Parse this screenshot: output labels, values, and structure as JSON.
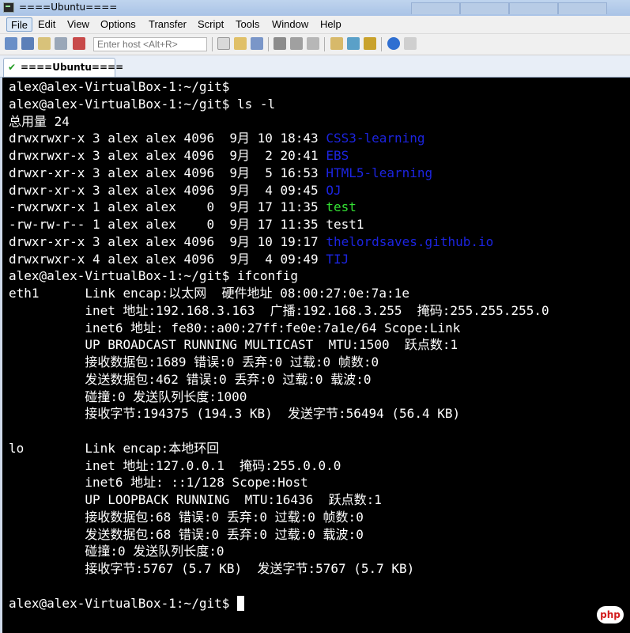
{
  "window": {
    "title": "====Ubuntu===="
  },
  "menu": [
    "File",
    "Edit",
    "View",
    "Options",
    "Transfer",
    "Script",
    "Tools",
    "Window",
    "Help"
  ],
  "toolbar": {
    "quick_connect_placeholder": "Enter host <Alt+R>"
  },
  "tabs": [
    {
      "label": "====Ubuntu===="
    }
  ],
  "terminal": {
    "lines": [
      {
        "segs": [
          {
            "t": "alex@alex-VirtualBox-1:~/git$",
            "c": ""
          }
        ]
      },
      {
        "segs": [
          {
            "t": "alex@alex-VirtualBox-1:~/git$ ls -l",
            "c": ""
          }
        ]
      },
      {
        "segs": [
          {
            "t": "总用量 24",
            "c": ""
          }
        ]
      },
      {
        "segs": [
          {
            "t": "drwxrwxr-x 3 alex alex 4096  9月 10 18:43 ",
            "c": ""
          },
          {
            "t": "CSS3-learning",
            "c": "blue"
          }
        ]
      },
      {
        "segs": [
          {
            "t": "drwxrwxr-x 3 alex alex 4096  9月  2 20:41 ",
            "c": ""
          },
          {
            "t": "EBS",
            "c": "blue"
          }
        ]
      },
      {
        "segs": [
          {
            "t": "drwxr-xr-x 3 alex alex 4096  9月  5 16:53 ",
            "c": ""
          },
          {
            "t": "HTML5-learning",
            "c": "blue"
          }
        ]
      },
      {
        "segs": [
          {
            "t": "drwxr-xr-x 3 alex alex 4096  9月  4 09:45 ",
            "c": ""
          },
          {
            "t": "OJ",
            "c": "blue"
          }
        ]
      },
      {
        "segs": [
          {
            "t": "-rwxrwxr-x 1 alex alex    0  9月 17 11:35 ",
            "c": ""
          },
          {
            "t": "test",
            "c": "green"
          }
        ]
      },
      {
        "segs": [
          {
            "t": "-rw-rw-r-- 1 alex alex    0  9月 17 11:35 test1",
            "c": ""
          }
        ]
      },
      {
        "segs": [
          {
            "t": "drwxr-xr-x 3 alex alex 4096  9月 10 19:17 ",
            "c": ""
          },
          {
            "t": "thelordsaves.github.io",
            "c": "blue"
          }
        ]
      },
      {
        "segs": [
          {
            "t": "drwxrwxr-x 4 alex alex 4096  9月  4 09:49 ",
            "c": ""
          },
          {
            "t": "TIJ",
            "c": "blue"
          }
        ]
      },
      {
        "segs": [
          {
            "t": "alex@alex-VirtualBox-1:~/git$ ifconfig",
            "c": ""
          }
        ]
      },
      {
        "segs": [
          {
            "t": "eth1      Link encap:以太网  硬件地址 08:00:27:0e:7a:1e",
            "c": ""
          }
        ]
      },
      {
        "segs": [
          {
            "t": "          inet 地址:192.168.3.163  广播:192.168.3.255  掩码:255.255.255.0",
            "c": ""
          }
        ]
      },
      {
        "segs": [
          {
            "t": "          inet6 地址: fe80::a00:27ff:fe0e:7a1e/64 Scope:Link",
            "c": ""
          }
        ]
      },
      {
        "segs": [
          {
            "t": "          UP BROADCAST RUNNING MULTICAST  MTU:1500  跃点数:1",
            "c": ""
          }
        ]
      },
      {
        "segs": [
          {
            "t": "          接收数据包:1689 错误:0 丢弃:0 过载:0 帧数:0",
            "c": ""
          }
        ]
      },
      {
        "segs": [
          {
            "t": "          发送数据包:462 错误:0 丢弃:0 过载:0 载波:0",
            "c": ""
          }
        ]
      },
      {
        "segs": [
          {
            "t": "          碰撞:0 发送队列长度:1000",
            "c": ""
          }
        ]
      },
      {
        "segs": [
          {
            "t": "          接收字节:194375 (194.3 KB)  发送字节:56494 (56.4 KB)",
            "c": ""
          }
        ]
      },
      {
        "segs": [
          {
            "t": "",
            "c": ""
          }
        ]
      },
      {
        "segs": [
          {
            "t": "lo        Link encap:本地环回",
            "c": ""
          }
        ]
      },
      {
        "segs": [
          {
            "t": "          inet 地址:127.0.0.1  掩码:255.0.0.0",
            "c": ""
          }
        ]
      },
      {
        "segs": [
          {
            "t": "          inet6 地址: ::1/128 Scope:Host",
            "c": ""
          }
        ]
      },
      {
        "segs": [
          {
            "t": "          UP LOOPBACK RUNNING  MTU:16436  跃点数:1",
            "c": ""
          }
        ]
      },
      {
        "segs": [
          {
            "t": "          接收数据包:68 错误:0 丢弃:0 过载:0 帧数:0",
            "c": ""
          }
        ]
      },
      {
        "segs": [
          {
            "t": "          发送数据包:68 错误:0 丢弃:0 过载:0 载波:0",
            "c": ""
          }
        ]
      },
      {
        "segs": [
          {
            "t": "          碰撞:0 发送队列长度:0",
            "c": ""
          }
        ]
      },
      {
        "segs": [
          {
            "t": "          接收字节:5767 (5.7 KB)  发送字节:5767 (5.7 KB)",
            "c": ""
          }
        ]
      },
      {
        "segs": [
          {
            "t": "",
            "c": ""
          }
        ]
      },
      {
        "segs": [
          {
            "t": "alex@alex-VirtualBox-1:~/git$ ",
            "c": ""
          }
        ],
        "cursor": true
      }
    ]
  },
  "watermark": {
    "text": "php"
  },
  "colors": {
    "directory": "#1c24e0",
    "executable": "#34e234",
    "terminal_bg": "#000000",
    "terminal_fg": "#ffffff"
  }
}
